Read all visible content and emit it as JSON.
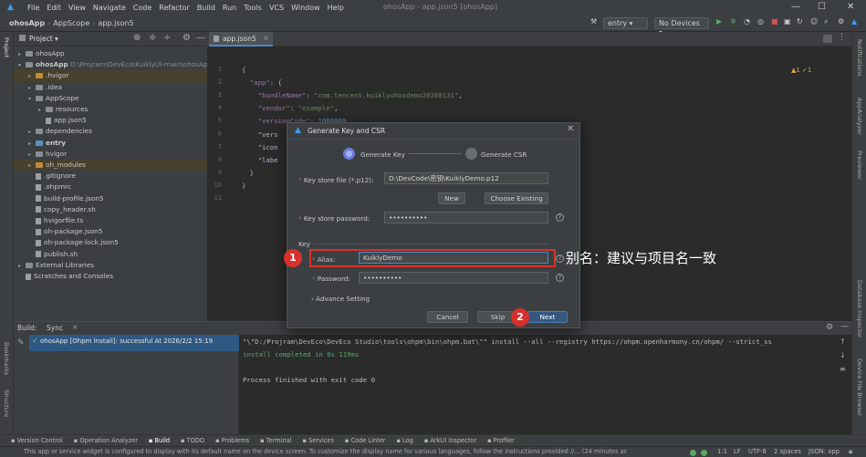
{
  "menu": {
    "items": [
      "File",
      "Edit",
      "View",
      "Navigate",
      "Code",
      "Refactor",
      "Build",
      "Run",
      "Tools",
      "VCS",
      "Window",
      "Help"
    ],
    "title": "ohosApp - app.json5 [ohosApp]"
  },
  "toolbar": {
    "breadcrumb": [
      "ohosApp",
      "AppScope",
      "app.json5"
    ],
    "run_config": "entry",
    "device": "No Devices"
  },
  "project": {
    "header": "Project",
    "rows": [
      {
        "label": "ohosApp",
        "indent": 0,
        "kind": "folder",
        "arrow": "▸"
      },
      {
        "label": "ohosApp",
        "extra": "D:\\Projram\\DevEco\\KuiklyUI-main\\ohosAp",
        "indent": 0,
        "kind": "folder",
        "arrow": "▾",
        "bold": true
      },
      {
        "label": ".hvigor",
        "indent": 1,
        "kind": "folder-orange",
        "arrow": "▸",
        "mod": true
      },
      {
        "label": ".idea",
        "indent": 1,
        "kind": "folder",
        "arrow": "▸"
      },
      {
        "label": "AppScope",
        "indent": 1,
        "kind": "folder",
        "arrow": "▾"
      },
      {
        "label": "resources",
        "indent": 2,
        "kind": "folder",
        "arrow": "▸"
      },
      {
        "label": "app.json5",
        "indent": 2,
        "kind": "file",
        "arrow": ""
      },
      {
        "label": "dependencies",
        "indent": 1,
        "kind": "folder",
        "arrow": "▸"
      },
      {
        "label": "entry",
        "indent": 1,
        "kind": "folder-blue",
        "arrow": "▸",
        "bold": true
      },
      {
        "label": "hvigor",
        "indent": 1,
        "kind": "folder",
        "arrow": "▸"
      },
      {
        "label": "oh_modules",
        "indent": 1,
        "kind": "folder-orange",
        "arrow": "▸",
        "mod": true
      },
      {
        "label": ".gitignore",
        "indent": 1,
        "kind": "file",
        "arrow": ""
      },
      {
        "label": ".ohpmrc",
        "indent": 1,
        "kind": "file",
        "arrow": ""
      },
      {
        "label": "build-profile.json5",
        "indent": 1,
        "kind": "file",
        "arrow": ""
      },
      {
        "label": "copy_header.sh",
        "indent": 1,
        "kind": "file",
        "arrow": ""
      },
      {
        "label": "hvigorfile.ts",
        "indent": 1,
        "kind": "file",
        "arrow": ""
      },
      {
        "label": "oh-package.json5",
        "indent": 1,
        "kind": "file",
        "arrow": ""
      },
      {
        "label": "oh-package-lock.json5",
        "indent": 1,
        "kind": "file",
        "arrow": ""
      },
      {
        "label": "publish.sh",
        "indent": 1,
        "kind": "file",
        "arrow": ""
      },
      {
        "label": "External Libraries",
        "indent": 0,
        "kind": "folder",
        "arrow": "▸"
      },
      {
        "label": "Scratches and Consoles",
        "indent": 0,
        "kind": "file",
        "arrow": ""
      }
    ]
  },
  "editor": {
    "tab": "app.json5",
    "inspection": "▲1 ✓1",
    "lines": [
      {
        "n": "1",
        "html": "{"
      },
      {
        "n": "2",
        "html": "  \"app\": {"
      },
      {
        "n": "3",
        "html": "    \"bundleName\": \"com.tencent.kuiklyohosdemo20260131\","
      },
      {
        "n": "4",
        "html": "    \"vendor\": \"example\","
      },
      {
        "n": "5",
        "html": "    \"versionCode\": 1000000,"
      },
      {
        "n": "6",
        "html": "    \"vers"
      },
      {
        "n": "7",
        "html": "    \"icon"
      },
      {
        "n": "8",
        "html": "    \"labe"
      },
      {
        "n": "9",
        "html": "  }"
      },
      {
        "n": "10",
        "html": "}"
      },
      {
        "n": "11",
        "html": ""
      }
    ]
  },
  "dialog": {
    "title": "Generate Key and CSR",
    "step1": "Generate Key",
    "step2": "Generate CSR",
    "keystore_label": "Key store file (*.p12):",
    "keystore_value": "D:\\DevCode\\密钥\\KuiklyDemo.p12",
    "new_btn": "New",
    "choose_btn": "Choose Existing",
    "kspwd_label": "Key store password:",
    "kspwd_value": "••••••••••",
    "key_section": "Key",
    "alias_label": "Alias:",
    "alias_value": "KuiklyDemo",
    "pwd_label": "Password:",
    "pwd_value": "••••••••••",
    "advance": "Advance Setting",
    "cancel_btn": "Cancel",
    "skip_btn": "Skip",
    "next_btn": "Next"
  },
  "annotations": {
    "badge1": "1",
    "badge2": "2",
    "note": "别名：建议与项目名一致",
    "accent": "#d7312b"
  },
  "build": {
    "tabs": [
      "Build:",
      "Sync"
    ],
    "task": "ohosApp [Ohpm Install]: successful At 2026/2/2 15:19",
    "console": [
      "\"\\\"D:/Projram\\DevEco\\DevEco Studio\\tools\\ohpm\\bin\\ohpm.bat\\\"\" install --all --registry https://ohpm.openharmony.cn/ohpm/ --strict_ss",
      "install completed in 0s 119ms",
      "",
      "Process finished with exit code 0"
    ]
  },
  "bottom_tabs": [
    "Version Control",
    "Operation Analyzer",
    "Build",
    "TODO",
    "Problems",
    "Terminal",
    "Services",
    "Code Linter",
    "Log",
    "ArkUI Inspector",
    "Profiler"
  ],
  "status": {
    "message": "This app or service widget is configured to display with its default name on the device screen. To customize the display name for various languages, follow the instructions provided //... (24 minutes ac",
    "right": [
      "1:1",
      "LF",
      "UTF-8",
      "2 spaces",
      "JSON: app"
    ]
  },
  "side_left": [
    "Project",
    "Bookmarks",
    "Structure"
  ],
  "side_right": [
    "Notifications",
    "AppAnalyzer",
    "Previewer",
    "Database Inspector",
    "Device File Browser"
  ]
}
